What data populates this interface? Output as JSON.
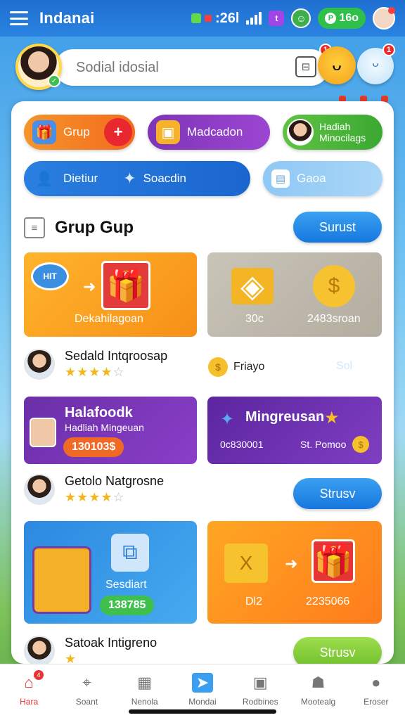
{
  "status_bar": {
    "app_title": "Indanai",
    "clock_red": "■",
    "clock_time": ":26l",
    "purple_badge": "t",
    "coin_value": "16o",
    "coin_icon": "P"
  },
  "search": {
    "placeholder": "Sodial idosial",
    "badge_1": "1",
    "badge_2": "1"
  },
  "quick_actions": {
    "grup": "Grup",
    "madcadon": "Madcadon",
    "hadiah_line1": "Hadiah",
    "hadiah_line2": "Minocilags",
    "dietiur": "Dietiur",
    "soacdin": "Soacdin",
    "gaoa": "Gaoa"
  },
  "section": {
    "title": "Grup Gup",
    "button": "Surust"
  },
  "tiles": {
    "t1_label": "Dekahilagoan",
    "t1_speech": "HIT",
    "t2_left": "30c",
    "t2_right": "2483sroan",
    "t3_title": "Halafoodk",
    "t3_sub": "Hadliah Mingeuan",
    "t3_price": "130103$",
    "t4_title": "Mingreusan",
    "t4_left": "0c830001",
    "t4_right": "St. Pomoo",
    "t5_label": "Sesdiart",
    "t5_price": "138785",
    "t6_left": "Dl2",
    "t6_right": "2235066"
  },
  "rows": [
    {
      "name": "Sedald Intqroosap",
      "stars_on": "★★★★",
      "stars_off": "☆",
      "side_label": "Friayo",
      "side_ghost": "Sol"
    },
    {
      "name": "Getolo Natgrosne",
      "stars_on": "★★★★",
      "stars_off": "☆",
      "button": "Strusv"
    },
    {
      "name": "Satoak Intigreno",
      "stars_on": "★",
      "stars_off": "",
      "button": "Strusv"
    }
  ],
  "nav": [
    {
      "label": "Hara",
      "icon": "home-icon",
      "badge": "4"
    },
    {
      "label": "Soant",
      "icon": "people-icon"
    },
    {
      "label": "Nenola",
      "icon": "box-icon"
    },
    {
      "label": "Mondai",
      "icon": "send-icon"
    },
    {
      "label": "Rodbines",
      "icon": "gift-icon"
    },
    {
      "label": "Mootealg",
      "icon": "group-icon"
    },
    {
      "label": "Eroser",
      "icon": "profile-icon"
    }
  ],
  "colors": {
    "primary_blue": "#1f6fd1",
    "accent_red": "#e53535",
    "accent_green": "#3fbf4c",
    "accent_purple": "#7d35b8",
    "accent_orange": "#f78f18"
  }
}
